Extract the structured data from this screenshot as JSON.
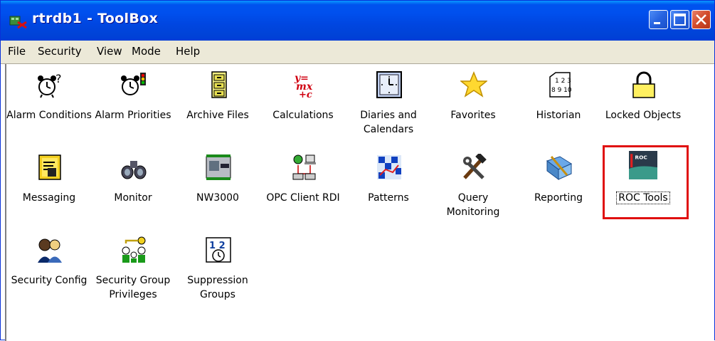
{
  "window": {
    "title": "rtrdb1 - ToolBox"
  },
  "menu": [
    "File",
    "Security",
    "View",
    "Mode",
    "Help"
  ],
  "items": [
    {
      "label": "Alarm Conditions",
      "icon": "alarm-clock-question-icon"
    },
    {
      "label": "Alarm Priorities",
      "icon": "alarm-clock-traffic-light-icon"
    },
    {
      "label": "Archive Files",
      "icon": "filing-cabinet-icon"
    },
    {
      "label": "Calculations",
      "icon": "formula-icon",
      "formula": "y=mx+c"
    },
    {
      "label": "Diaries and Calendars",
      "icon": "wall-clock-icon"
    },
    {
      "label": "Favorites",
      "icon": "star-icon"
    },
    {
      "label": "Historian",
      "icon": "historian-digits-icon",
      "digits": [
        "1 2 3",
        "8 9 10"
      ]
    },
    {
      "label": "Locked Objects",
      "icon": "padlock-icon"
    },
    {
      "label": "Messaging",
      "icon": "messaging-book-icon"
    },
    {
      "label": "Monitor",
      "icon": "binoculars-icon"
    },
    {
      "label": "NW3000",
      "icon": "nw3000-device-icon"
    },
    {
      "label": "OPC Client RDI",
      "icon": "opc-network-icon"
    },
    {
      "label": "Patterns",
      "icon": "patterns-grid-icon"
    },
    {
      "label": "Query Monitoring",
      "icon": "tools-hammer-wrench-icon"
    },
    {
      "label": "Reporting",
      "icon": "reporting-book-pen-icon"
    },
    {
      "label": "ROC Tools",
      "icon": "roc-tools-icon",
      "icon_text": "ROC",
      "selected": true
    },
    {
      "label": "Security Config",
      "icon": "security-people-icon"
    },
    {
      "label": "Security Group Privileges",
      "icon": "security-group-key-icon"
    },
    {
      "label": "Suppression Groups",
      "icon": "suppression-clock-icon",
      "digits": "1 2"
    }
  ],
  "colors": {
    "title_bar": "#0053ee",
    "menu_bg": "#ece9d8",
    "highlight": "#e01010"
  }
}
